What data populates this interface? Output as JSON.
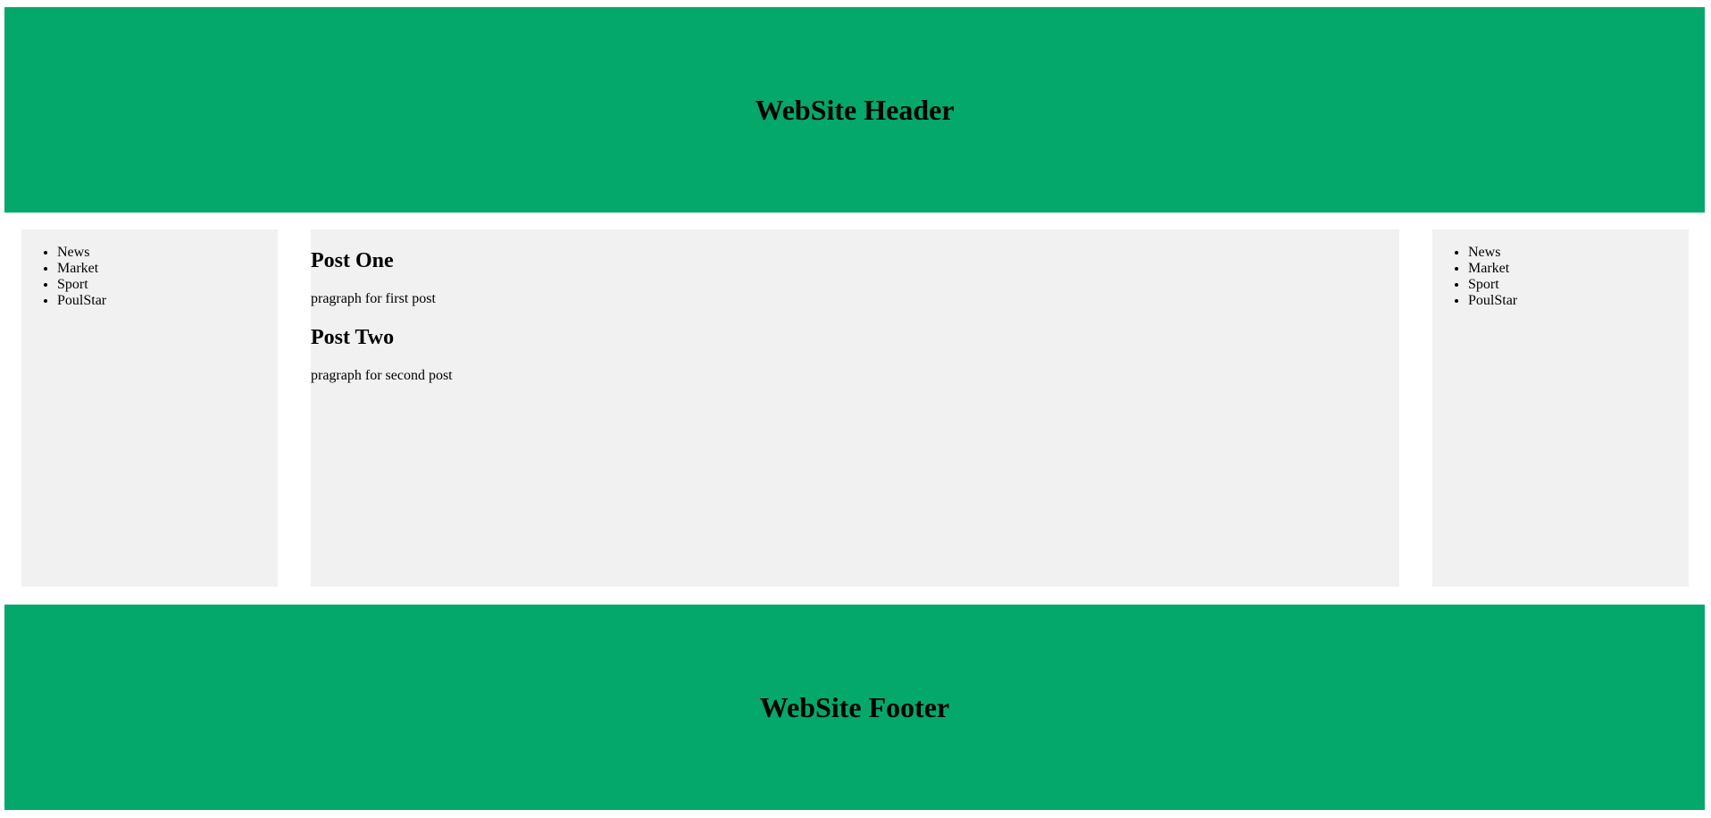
{
  "header": {
    "title": "WebSite Header"
  },
  "footer": {
    "title": "WebSite Footer"
  },
  "sidebar_left": {
    "items": [
      {
        "label": "News"
      },
      {
        "label": "Market"
      },
      {
        "label": "Sport"
      },
      {
        "label": "PoulStar"
      }
    ]
  },
  "sidebar_right": {
    "items": [
      {
        "label": "News"
      },
      {
        "label": "Market"
      },
      {
        "label": "Sport"
      },
      {
        "label": "PoulStar"
      }
    ]
  },
  "main": {
    "posts": [
      {
        "title": "Post One",
        "body": "pragraph for first post"
      },
      {
        "title": "Post Two",
        "body": "pragraph for second post"
      }
    ]
  },
  "colors": {
    "banner": "#04a86b",
    "panel": "#f1f1f1",
    "page": "#ffffff"
  }
}
